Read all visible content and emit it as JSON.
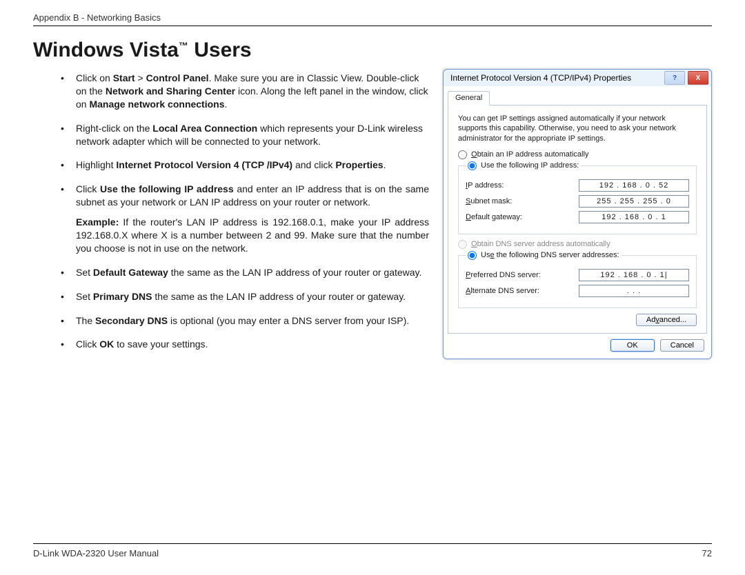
{
  "header": "Appendix B - Networking Basics",
  "title_main": "Windows Vista",
  "title_tm": "™",
  "title_suffix": " Users",
  "steps": {
    "s1a": "Click on ",
    "s1b": "Start",
    "s1c": " > ",
    "s1d": "Control Panel",
    "s1e": ". Make sure you are in Classic View. Double-click on the ",
    "s1f": "Network and Sharing Center",
    "s1g": " icon. Along the left panel in the window, click on ",
    "s1h": "Manage network connections",
    "s1i": ".",
    "s2a": "Right-click on the ",
    "s2b": "Local Area Connection",
    "s2c": " which represents your D-Link wireless network adapter which will be connected to your network.",
    "s3a": "Highlight ",
    "s3b": "Internet Protocol Version 4 (TCP /IPv4)",
    "s3c": " and click ",
    "s3d": "Properties",
    "s3e": ".",
    "s4a": "Click ",
    "s4b": "Use the following IP address",
    "s4c": " and enter an IP address that is on the same subnet as your network or LAN IP address on your router or network.",
    "exa": "Example:",
    "exb": " If the router's LAN IP address is 192.168.0.1, make your IP address 192.168.0.X where X is a number between 2 and 99. Make sure that the number you choose is not in use on the network.",
    "s5a": "Set ",
    "s5b": "Default Gateway",
    "s5c": " the same as the LAN IP address of your router or gateway.",
    "s6a": "Set ",
    "s6b": "Primary DNS",
    "s6c": " the same as the LAN IP address of your router or gateway.",
    "s7a": "The ",
    "s7b": "Secondary DNS",
    "s7c": " is optional (you may enter a DNS server from your ISP).",
    "s8a": "Click ",
    "s8b": "OK",
    "s8c": " to save your settings."
  },
  "dialog": {
    "title": "Internet Protocol Version 4 (TCP/IPv4) Properties",
    "tab_general": "General",
    "info": "You can get IP settings assigned automatically if your network supports this capability. Otherwise, you need to ask your network administrator for the appropriate IP settings.",
    "radio_auto_ip_pre": "O",
    "radio_auto_ip": "btain an IP address automatically",
    "radio_use_ip": "Use the following IP address:",
    "label_ip_pre": "I",
    "label_ip": "P address:",
    "label_subnet_pre": "S",
    "label_subnet": "ubnet mask:",
    "label_gateway_pre": "D",
    "label_gateway": "efault gateway:",
    "val_ip": "192 . 168 .  0  . 52",
    "val_subnet": "255 . 255 . 255 .  0",
    "val_gateway": "192 . 168 .  0  .  1",
    "radio_auto_dns_pre": "O",
    "radio_auto_dns": "btain DNS server address automatically",
    "radio_use_dns_pre": "Us",
    "radio_use_dns_mid": "e",
    "radio_use_dns": " the following DNS server addresses:",
    "label_pref_dns_pre": "P",
    "label_pref_dns": "referred DNS server:",
    "label_alt_dns_pre": "A",
    "label_alt_dns": "lternate DNS server:",
    "val_pref_dns": "192 . 168 .  0  .  1|",
    "val_alt_dns": "     .        .        .     ",
    "btn_advanced_pre": "Ad",
    "btn_advanced_mid": "v",
    "btn_advanced": "anced...",
    "btn_ok": "OK",
    "btn_cancel": "Cancel"
  },
  "footer": {
    "manual": "D-Link WDA-2320 User Manual",
    "page": "72"
  }
}
